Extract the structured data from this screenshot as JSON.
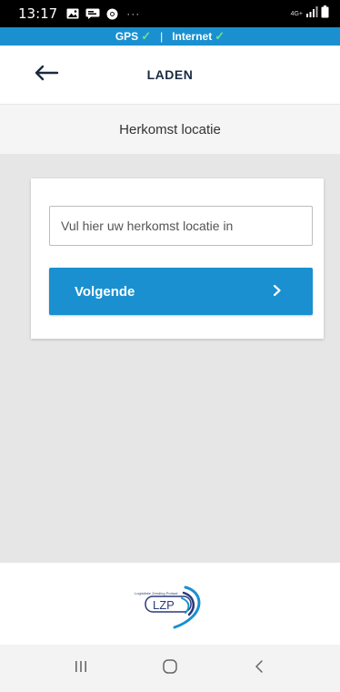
{
  "status_bar": {
    "time": "13:17",
    "more": "···",
    "network_type": "4G+",
    "icons": [
      "gallery-icon",
      "message-icon",
      "chrome-icon",
      "signal-icon",
      "battery-icon"
    ]
  },
  "connection": {
    "gps_label": "GPS",
    "separator": "|",
    "internet_label": "Internet",
    "status_color": "#6ee08a"
  },
  "header": {
    "title": "LADEN",
    "back_icon": "arrow-left-icon"
  },
  "section": {
    "title": "Herkomst locatie"
  },
  "form": {
    "location_value": "",
    "location_placeholder": "Vul hier uw herkomst locatie in",
    "next_label": "Volgende",
    "next_icon": "chevron-right-icon"
  },
  "footer": {
    "logo_text": "LZP",
    "logo_tagline": "Logistieke Zending Portaal",
    "logo_icon": "lzp-logo"
  },
  "nav": {
    "icons": [
      "recent-apps-icon",
      "home-icon",
      "back-icon"
    ]
  },
  "colors": {
    "accent": "#1a90d0",
    "background": "#e6e6e6",
    "header_text": "#1a2a40"
  }
}
